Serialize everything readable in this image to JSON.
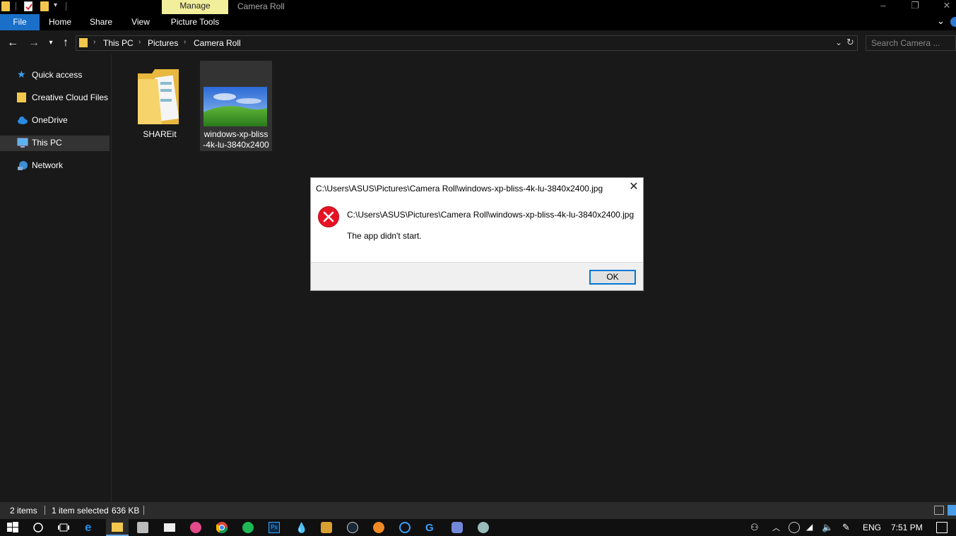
{
  "window": {
    "title": "Camera Roll",
    "manage_tab": "Manage",
    "minimize": "–",
    "restore": "❐",
    "close": "✕"
  },
  "ribbon": {
    "tabs": [
      "File",
      "Home",
      "Share",
      "View",
      "Picture Tools"
    ],
    "expand": "⌄"
  },
  "address": {
    "crumbs": [
      "This PC",
      "Pictures",
      "Camera Roll"
    ],
    "search_placeholder": "Search Camera ..."
  },
  "sidebar": {
    "items": [
      {
        "label": "Quick access",
        "icon": "star-icon"
      },
      {
        "label": "Creative Cloud Files",
        "icon": "cc-folder-icon"
      },
      {
        "label": "OneDrive",
        "icon": "cloud-icon"
      },
      {
        "label": "This PC",
        "icon": "pc-icon",
        "selected": true
      },
      {
        "label": "Network",
        "icon": "network-icon"
      }
    ]
  },
  "files": [
    {
      "name": "SHAREit",
      "type": "folder"
    },
    {
      "name_line1": "windows-xp-bliss",
      "name_line2": "-4k-lu-3840x2400",
      "type": "image",
      "selected": true
    }
  ],
  "dialog": {
    "title": "C:\\Users\\ASUS\\Pictures\\Camera Roll\\windows-xp-bliss-4k-lu-3840x2400.jpg",
    "path": "C:\\Users\\ASUS\\Pictures\\Camera Roll\\windows-xp-bliss-4k-lu-3840x2400.jpg",
    "message": "The app didn't start.",
    "ok": "OK",
    "close": "✕"
  },
  "status": {
    "items": "2 items",
    "selected": "1 item selected",
    "size": "636 KB"
  },
  "taskbar": {
    "language": "ENG",
    "time": "7:51 PM"
  },
  "colors": {
    "accent": "#1a6fc8",
    "manage_tab": "#f2ef9c",
    "error": "#e81123",
    "ok_border": "#0078d7"
  }
}
